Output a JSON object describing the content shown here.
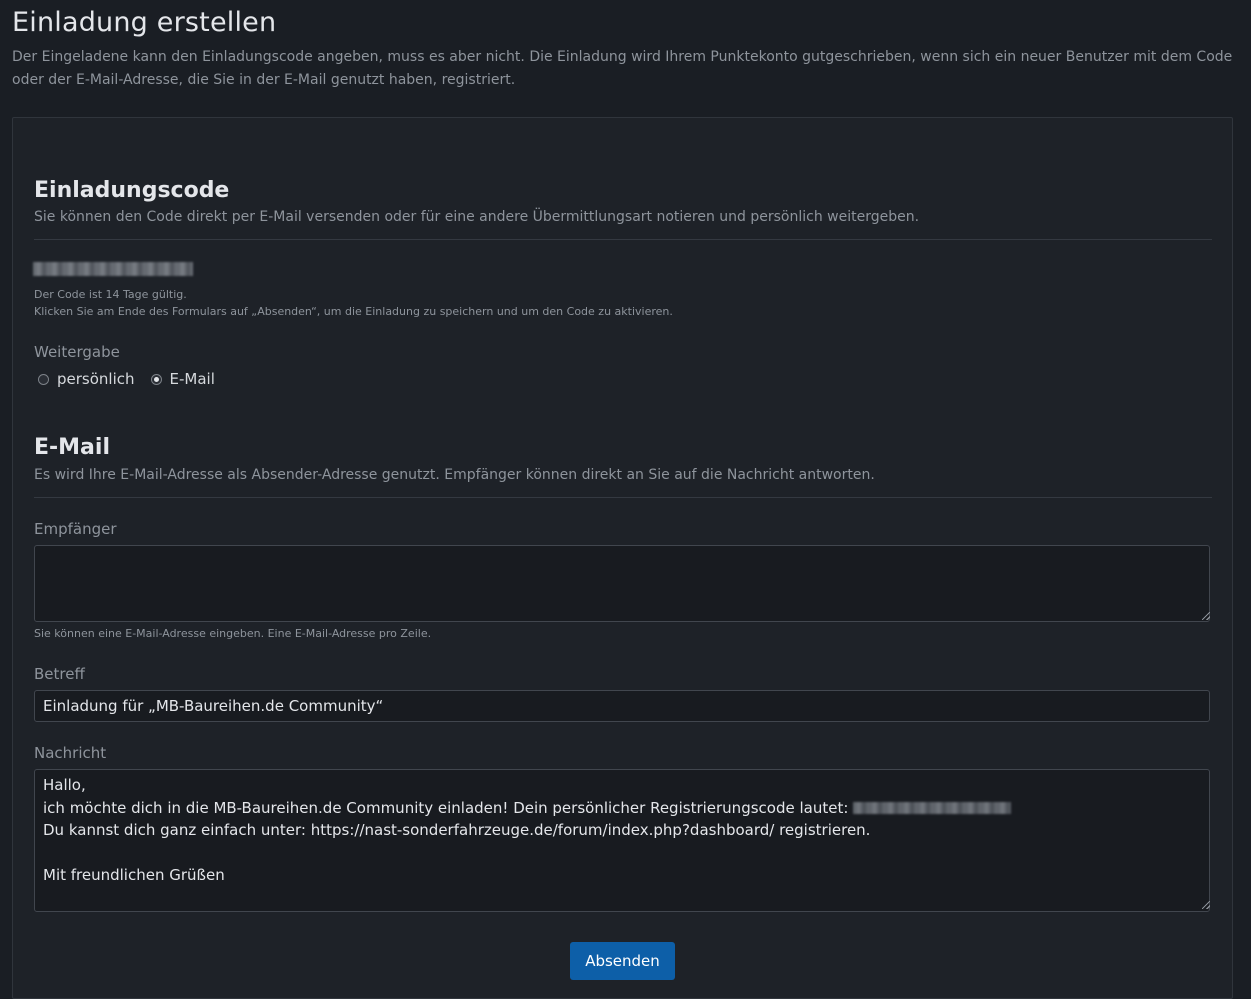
{
  "page": {
    "title": "Einladung erstellen",
    "description": "Der Eingeladene kann den Einladungscode angeben, muss es aber nicht. Die Einladung wird Ihrem Punktekonto gutgeschrieben, wenn sich ein neuer Benutzer mit dem Code oder der E-Mail-Adresse, die Sie in der E-Mail genutzt haben, registriert."
  },
  "invite_code_section": {
    "title": "Einladungscode",
    "description": "Sie können den Code direkt per E-Mail versenden oder für eine andere Übermittlungsart notieren und persönlich weitergeben.",
    "validity_note": "Der Code ist 14 Tage gültig.",
    "activation_note": "Klicken Sie am Ende des Formulars auf „Absenden“, um die Einladung zu speichern und um den Code zu aktivieren."
  },
  "sharing": {
    "label": "Weitergabe",
    "options": [
      {
        "label": "persönlich",
        "checked": false
      },
      {
        "label": "E-Mail",
        "checked": true
      }
    ]
  },
  "email_section": {
    "title": "E-Mail",
    "description": "Es wird Ihre E-Mail-Adresse als Absender-Adresse genutzt. Empfänger können direkt an Sie auf die Nachricht antworten.",
    "recipients_label": "Empfänger",
    "recipients_value": "",
    "recipients_hint": "Sie können eine E-Mail-Adresse eingeben. Eine E-Mail-Adresse pro Zeile.",
    "subject_label": "Betreff",
    "subject_value": "Einladung für „MB-Baureihen.de Community“",
    "message_label": "Nachricht",
    "message_lines": {
      "line1": "Hallo,",
      "line2": "ich möchte dich in die MB-Baureihen.de Community einladen! Dein persönlicher Registrierungscode lautet:",
      "line3": "Du kannst dich ganz einfach unter: https://nast-sonderfahrzeuge.de/forum/index.php?dashboard/ registrieren.",
      "line4": "",
      "line5": "Mit freundlichen Grüßen"
    }
  },
  "actions": {
    "submit_label": "Absenden"
  },
  "colors": {
    "background": "#1a1e24",
    "panel": "#1e2228",
    "accent": "#0d5fa8"
  }
}
